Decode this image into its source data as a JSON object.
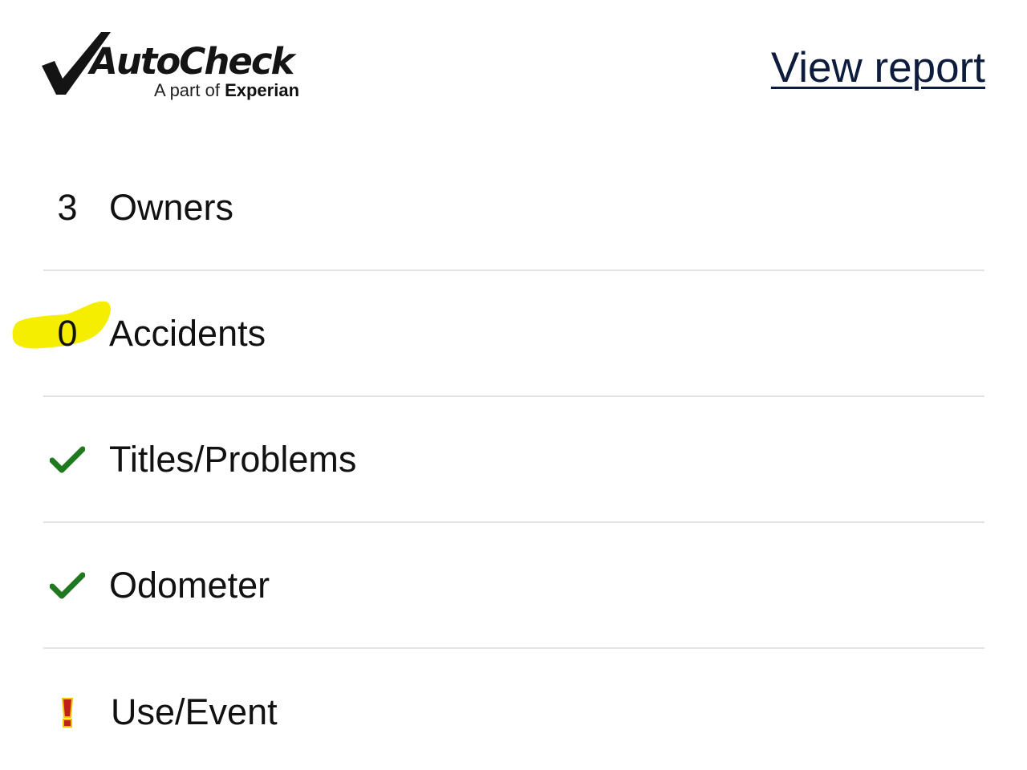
{
  "header": {
    "logo": {
      "wordmark": "AutoCheck",
      "tagline_prefix": "A part of",
      "tagline_brand": "Experian"
    },
    "view_report_label": "View report"
  },
  "rows": [
    {
      "indicator": "count",
      "count": "3",
      "label": "Owners"
    },
    {
      "indicator": "count",
      "count": "0",
      "label": "Accidents",
      "highlighted": true
    },
    {
      "indicator": "check-icon",
      "label": "Titles/Problems"
    },
    {
      "indicator": "check-icon",
      "label": "Odometer"
    },
    {
      "indicator": "exclamation-icon",
      "label": "Use/Event"
    }
  ],
  "colors": {
    "check": "#1f7a1f",
    "exclamation": "#c0201a",
    "exclamation_outline": "#f2c200",
    "highlight": "#f5ee00",
    "link": "#0d1b3c",
    "divider": "#e3e3e3"
  }
}
